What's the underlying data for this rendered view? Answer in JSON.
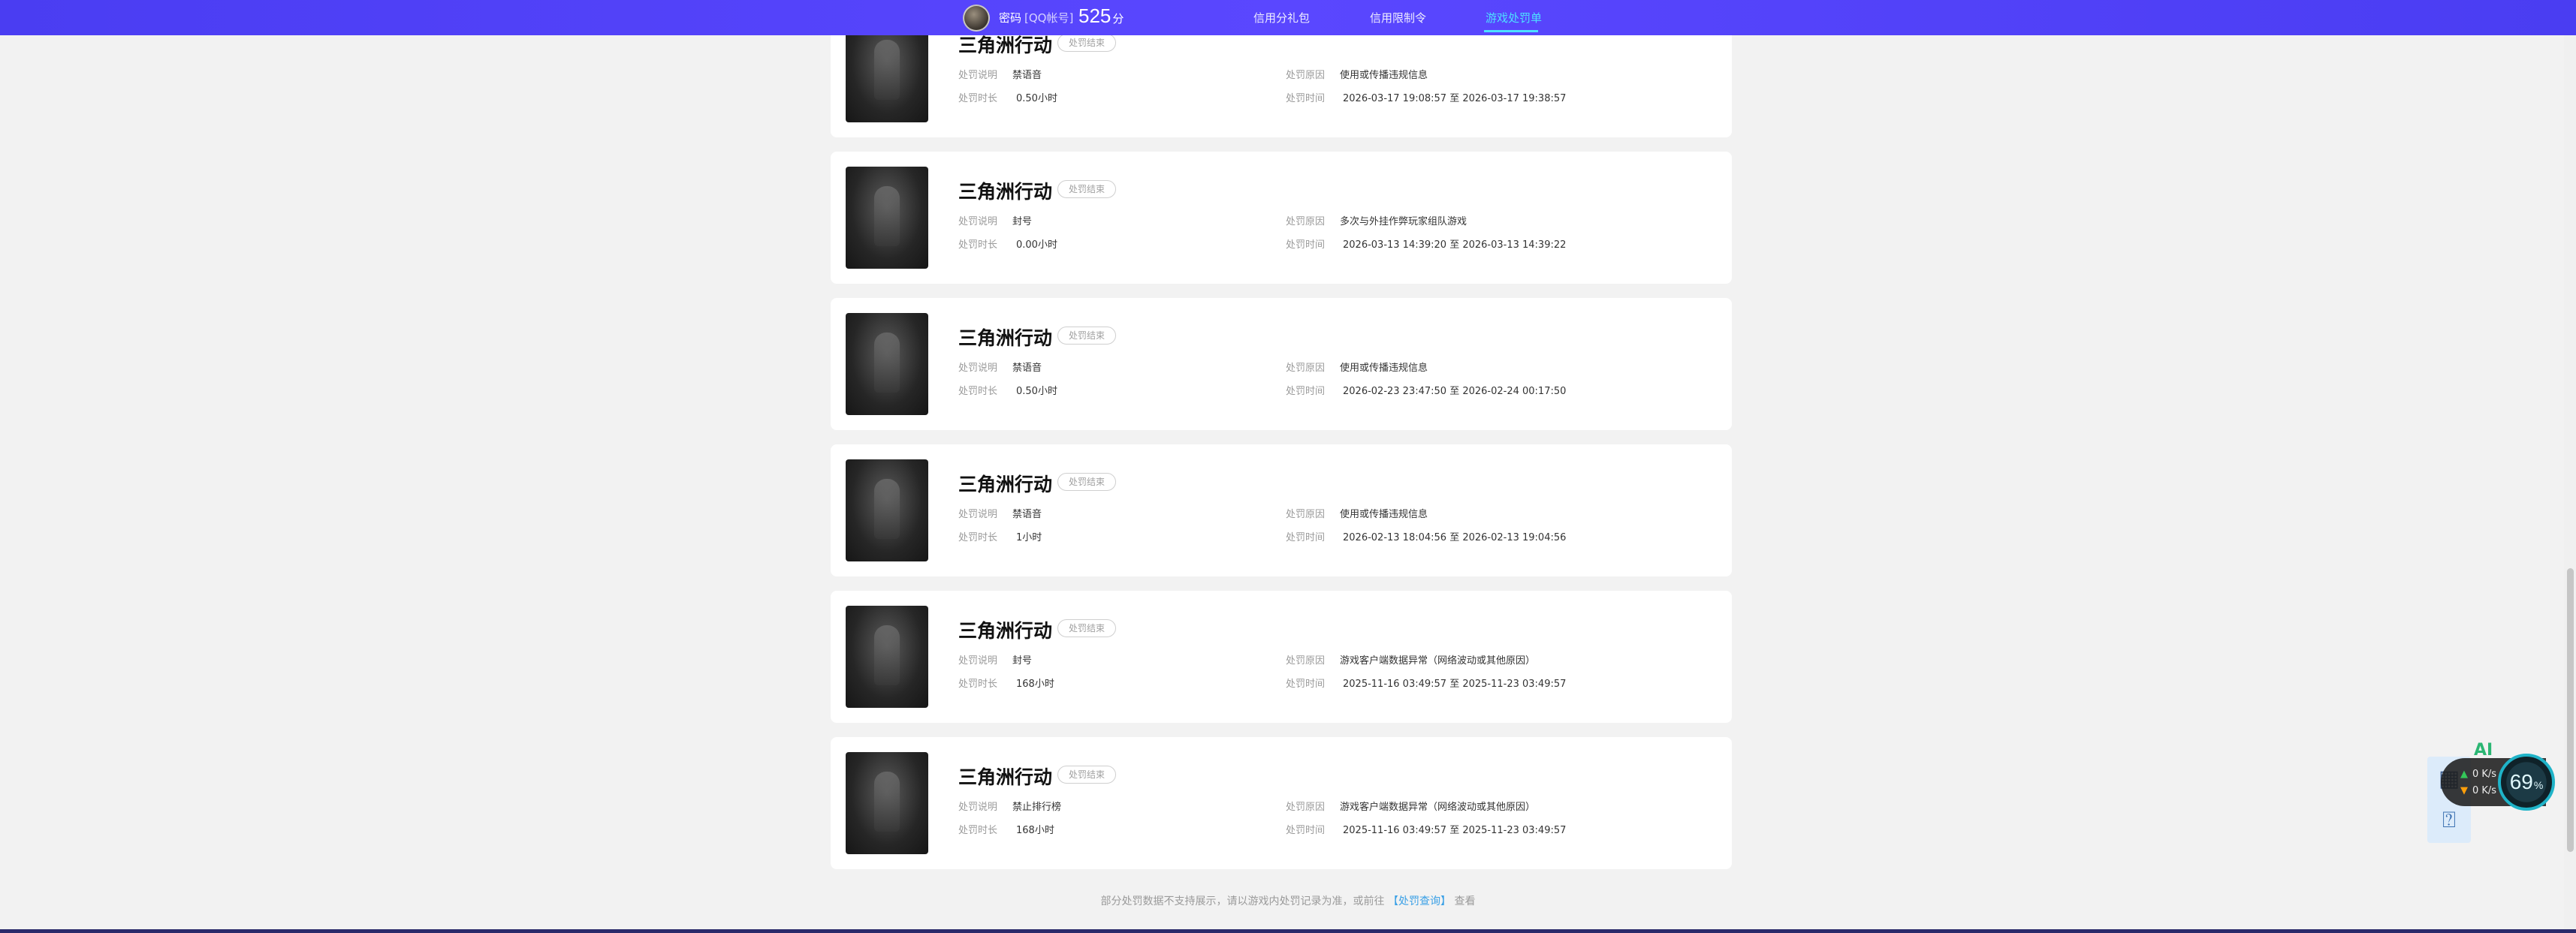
{
  "header": {
    "account_name": "密码",
    "account_type": "[QQ帐号]",
    "score": "525",
    "score_unit": "分",
    "nav": [
      {
        "label": "信用分礼包",
        "active": false
      },
      {
        "label": "信用限制令",
        "active": false
      },
      {
        "label": "游戏处罚单",
        "active": true
      }
    ]
  },
  "records": [
    {
      "title": "三角洲行动",
      "status": "处罚结束",
      "desc_label": "处罚说明",
      "desc": "禁语音",
      "dur_label": "处罚时长",
      "duration": "0.50小时",
      "reason_label": "处罚原因",
      "reason": "使用或传播违规信息",
      "time_label": "处罚时间",
      "time": "2026-03-17 19:08:57 至 2026-03-17 19:38:57"
    },
    {
      "title": "三角洲行动",
      "status": "处罚结束",
      "desc_label": "处罚说明",
      "desc": "封号",
      "dur_label": "处罚时长",
      "duration": "0.00小时",
      "reason_label": "处罚原因",
      "reason": "多次与外挂作弊玩家组队游戏",
      "time_label": "处罚时间",
      "time": "2026-03-13 14:39:20 至 2026-03-13 14:39:22"
    },
    {
      "title": "三角洲行动",
      "status": "处罚结束",
      "desc_label": "处罚说明",
      "desc": "禁语音",
      "dur_label": "处罚时长",
      "duration": "0.50小时",
      "reason_label": "处罚原因",
      "reason": "使用或传播违规信息",
      "time_label": "处罚时间",
      "time": "2026-02-23 23:47:50 至 2026-02-24 00:17:50"
    },
    {
      "title": "三角洲行动",
      "status": "处罚结束",
      "desc_label": "处罚说明",
      "desc": "禁语音",
      "dur_label": "处罚时长",
      "duration": "1小时",
      "reason_label": "处罚原因",
      "reason": "使用或传播违规信息",
      "time_label": "处罚时间",
      "time": "2026-02-13 18:04:56 至 2026-02-13 19:04:56"
    },
    {
      "title": "三角洲行动",
      "status": "处罚结束",
      "desc_label": "处罚说明",
      "desc": "封号",
      "dur_label": "处罚时长",
      "duration": "168小时",
      "reason_label": "处罚原因",
      "reason": "游戏客户端数据异常（网络波动或其他原因）",
      "time_label": "处罚时间",
      "time": "2025-11-16 03:49:57 至 2025-11-23 03:49:57"
    },
    {
      "title": "三角洲行动",
      "status": "处罚结束",
      "desc_label": "处罚说明",
      "desc": "禁止排行榜",
      "dur_label": "处罚时长",
      "duration": "168小时",
      "reason_label": "处罚原因",
      "reason": "游戏客户端数据异常（网络波动或其他原因）",
      "time_label": "处罚时间",
      "time": "2025-11-16 03:49:57 至 2025-11-23 03:49:57"
    }
  ],
  "footer": {
    "note_before": "部分处罚数据不支持展示，请以游戏内处罚记录为准，或前往",
    "link": "【处罚查询】",
    "note_after": "查看"
  },
  "widgets": {
    "ai_label": "AI",
    "up_speed": "0 K/s",
    "down_speed": "0 K/s",
    "gauge_value": "69",
    "gauge_unit": "%"
  },
  "colors": {
    "header_bg": "#5a47ff",
    "nav_active": "#4de0ff",
    "link": "#3aa0e6"
  }
}
